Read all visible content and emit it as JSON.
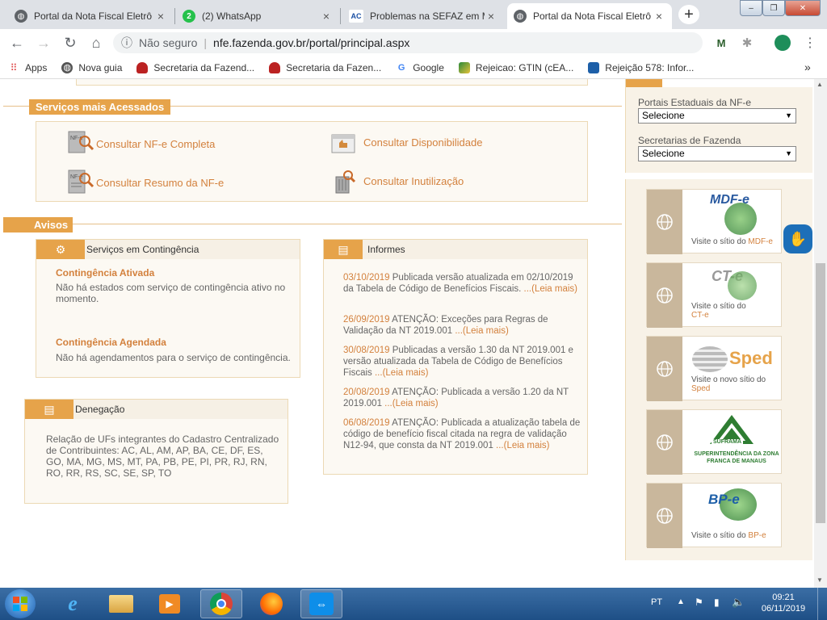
{
  "browser": {
    "tabs": [
      {
        "title": "Portal da Nota Fiscal Eletrô",
        "active": false
      },
      {
        "title": "(2) WhatsApp",
        "badge": "2",
        "active": false
      },
      {
        "title": "Problemas na SEFAZ em M",
        "badge": "AC",
        "active": false
      },
      {
        "title": "Portal da Nota Fiscal Eletrô",
        "active": true
      }
    ],
    "new_tab": "+",
    "close_glyph": "×",
    "window_controls": {
      "minimize": "–",
      "restore": "❐",
      "close": "✕"
    },
    "omnibox": {
      "security": "Não seguro",
      "url": "nfe.fazenda.gov.br/portal/principal.aspx"
    },
    "extension_badge": "M"
  },
  "bookmarks": [
    {
      "label": "Apps",
      "icon": "apps-grid-icon"
    },
    {
      "label": "Nova guia",
      "icon": "globe-icon"
    },
    {
      "label": "Secretaria da Fazend...",
      "icon": "sefaz-icon"
    },
    {
      "label": "Secretaria da Fazen...",
      "icon": "sefaz-icon"
    },
    {
      "label": "Google",
      "icon": "google-icon",
      "glyph": "G"
    },
    {
      "label": "Rejeicao: GTIN (cEA...",
      "icon": "gtin-icon"
    },
    {
      "label": "Rejeição 578: Infor...",
      "icon": "rejeicao-icon"
    }
  ],
  "bookmarks_more": "»",
  "servicos": {
    "title": "Serviços mais Acessados",
    "items": [
      {
        "label": "Consultar NF-e Completa"
      },
      {
        "label": "Consultar Disponibilidade"
      },
      {
        "label": "Consultar Resumo da NF-e"
      },
      {
        "label": "Consultar Inutilização"
      }
    ]
  },
  "avisos": {
    "title": "Avisos",
    "contingencia": {
      "header": "Serviços em Contingência",
      "ativada_title": "Contingência Ativada",
      "ativada_text": "Não há estados com serviço de contingência ativo no momento.",
      "agendada_title": "Contingência Agendada",
      "agendada_text": "Não há agendamentos para o serviço de contingência."
    },
    "denegacao": {
      "header": "Denegação",
      "text": "Relação de UFs integrantes do Cadastro Centralizado de Contribuintes: AC, AL, AM, AP, BA, CE, DF, ES, GO, MA, MG, MS, MT, PA, PB, PE, PI, PR, RJ, RN, RO, RR, RS, SC, SE, SP, TO"
    },
    "informes": {
      "header": "Informes",
      "items": [
        {
          "date": "03/10/2019",
          "text": " Publicada versão atualizada em 02/10/2019 da Tabela de Código de Benefícios Fiscais. ",
          "more": "...(Leia mais)"
        },
        {
          "date": "26/09/2019",
          "text": " ATENÇÃO: Exceções para Regras de Validação da NT 2019.001 ",
          "more": "...(Leia mais)"
        },
        {
          "date": "30/08/2019",
          "text": " Publicadas a versão 1.30 da NT 2019.001 e versão atualizada da Tabela de Código de Benefícios Fiscais ",
          "more": "...(Leia mais)"
        },
        {
          "date": "20/08/2019",
          "text": " ATENÇÃO: Publicada a versão 1.20 da NT 2019.001 ",
          "more": "...(Leia mais)"
        },
        {
          "date": "06/08/2019",
          "text": " ATENÇÃO: Publicada a atualização tabela de código de benefício fiscal citada na regra de validação N12-94, que consta da NT 2019.001 ",
          "more": "...(Leia mais)"
        }
      ]
    }
  },
  "sidebar": {
    "portais_label": "Portais Estaduais da NF-e",
    "portais_value": "Selecione",
    "secretarias_label": "Secretarias de Fazenda",
    "secretarias_value": "Selecione",
    "banners": [
      {
        "logo": "MDF-e",
        "visit": "Visite o sítio do ",
        "link": "MDF-e"
      },
      {
        "logo": "CT-e",
        "visit": "Visite o sítio do ",
        "link": "CT-e"
      },
      {
        "logo": "Sped",
        "visit": "Visite o novo sítio do ",
        "link": "Sped"
      },
      {
        "logo": "SUFRAMA",
        "sub": "SUPERINTENDÊNCIA DA ZONA FRANCA DE MANAUS"
      },
      {
        "logo": "BP-e",
        "visit": "Visite o sítio do ",
        "link": "BP-e"
      }
    ]
  },
  "taskbar": {
    "lang": "PT",
    "time": "09:21",
    "date": "06/11/2019"
  },
  "colors": {
    "accent": "#e6a34a",
    "link": "#d3813d",
    "panel_bg": "#fcf9f3"
  }
}
